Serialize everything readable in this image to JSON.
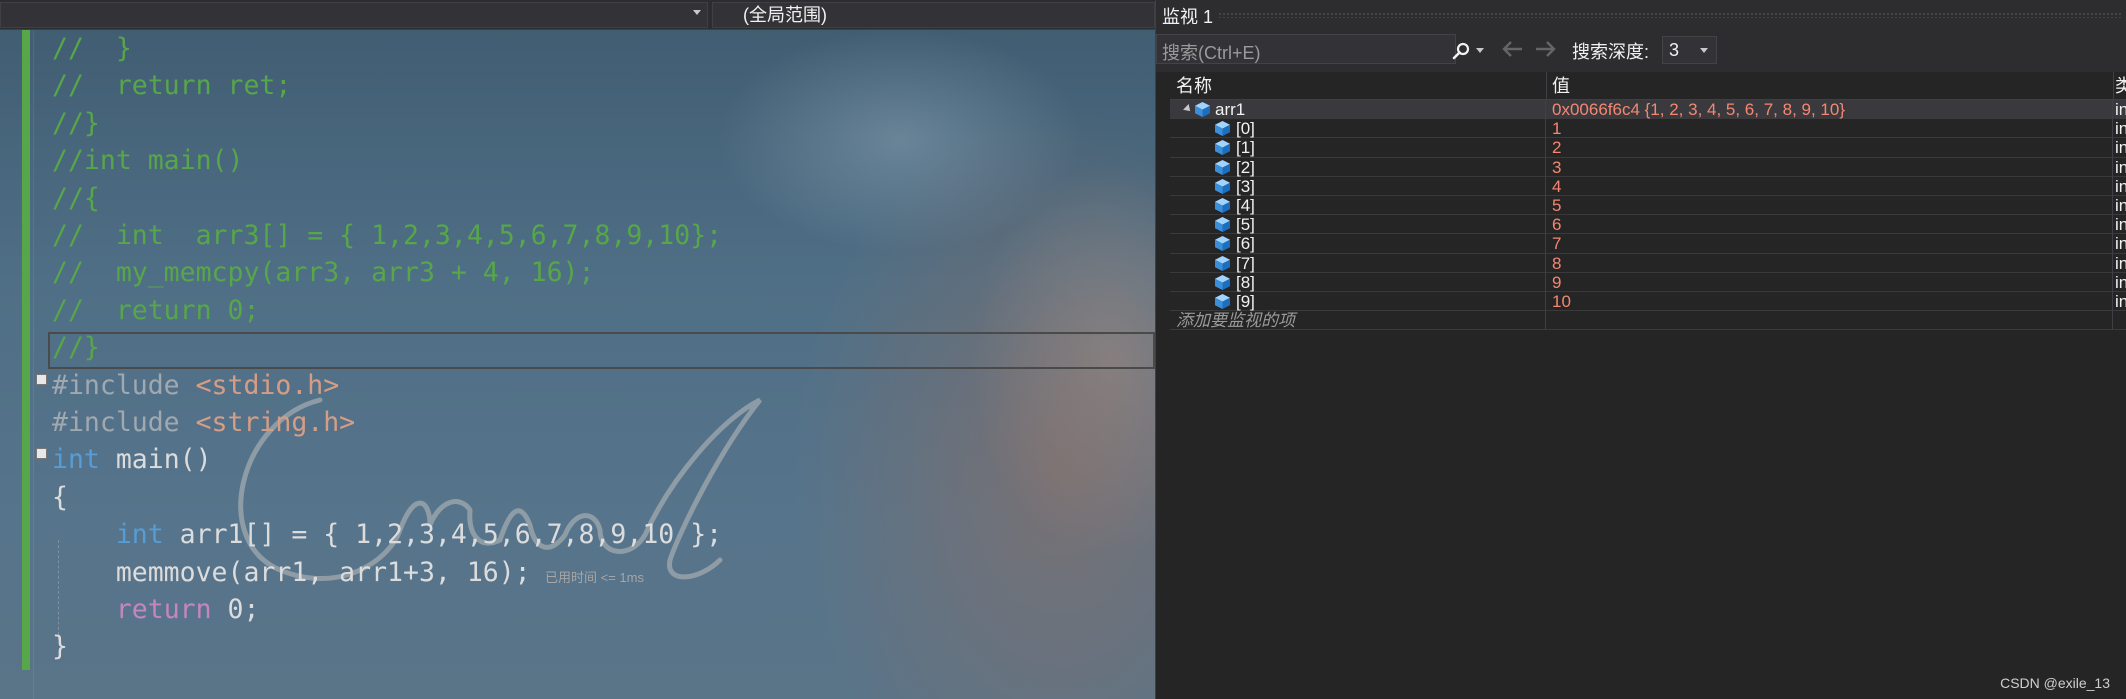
{
  "editor": {
    "scope_label": "(全局范围)",
    "perf_tip": "已用时间 <= 1ms",
    "lines": [
      [
        {
          "t": "//  }",
          "c": "cmt"
        }
      ],
      [
        {
          "t": "//  return ret;",
          "c": "cmt"
        }
      ],
      [
        {
          "t": "//}",
          "c": "cmt"
        }
      ],
      [
        {
          "t": "//int main()",
          "c": "cmt"
        }
      ],
      [
        {
          "t": "//{",
          "c": "cmt"
        }
      ],
      [
        {
          "t": "//  int  arr3[] = { 1,2,3,4,5,6,7,8,9,10};",
          "c": "cmt"
        }
      ],
      [
        {
          "t": "//  my_memcpy(arr3, arr3 + 4, 16);",
          "c": "cmt"
        }
      ],
      [
        {
          "t": "//  return 0;",
          "c": "cmt"
        }
      ],
      [
        {
          "t": "//}",
          "c": "cmt"
        }
      ],
      [
        {
          "t": "#include ",
          "c": "pp"
        },
        {
          "t": "<stdio.h>",
          "c": "str"
        }
      ],
      [
        {
          "t": "#include ",
          "c": "pp"
        },
        {
          "t": "<string.h>",
          "c": "str"
        }
      ],
      [
        {
          "t": "int",
          "c": "kw"
        },
        {
          "t": " main()",
          "c": ""
        }
      ],
      [
        {
          "t": "{",
          "c": ""
        }
      ],
      [
        {
          "t": "    ",
          "c": ""
        },
        {
          "t": "int",
          "c": "kw"
        },
        {
          "t": " arr1[] = { 1,2,3,4,5,6,7,8,9,10 };",
          "c": ""
        }
      ],
      [
        {
          "t": "    memmove(arr1, arr1+3, 16);",
          "c": ""
        }
      ],
      [
        {
          "t": "    ",
          "c": ""
        },
        {
          "t": "return",
          "c": "ret2"
        },
        {
          "t": " 0;",
          "c": ""
        }
      ],
      [
        {
          "t": "}",
          "c": ""
        }
      ]
    ]
  },
  "watch": {
    "title": "监视 1",
    "search_placeholder": "搜索(Ctrl+E)",
    "depth_label": "搜索深度:",
    "depth_value": "3",
    "columns": {
      "name": "名称",
      "value": "值",
      "type": "类"
    },
    "root": {
      "name": "arr1",
      "value": "0x0066f6c4 {1, 2, 3, 4, 5, 6, 7, 8, 9, 10}",
      "type": "in"
    },
    "items": [
      {
        "name": "[0]",
        "value": "1",
        "type": "in"
      },
      {
        "name": "[1]",
        "value": "2",
        "type": "in"
      },
      {
        "name": "[2]",
        "value": "3",
        "type": "in"
      },
      {
        "name": "[3]",
        "value": "4",
        "type": "in"
      },
      {
        "name": "[4]",
        "value": "5",
        "type": "in"
      },
      {
        "name": "[5]",
        "value": "6",
        "type": "in"
      },
      {
        "name": "[6]",
        "value": "7",
        "type": "in"
      },
      {
        "name": "[7]",
        "value": "8",
        "type": "in"
      },
      {
        "name": "[8]",
        "value": "9",
        "type": "in"
      },
      {
        "name": "[9]",
        "value": "10",
        "type": "in"
      }
    ],
    "add_item_text": "添加要监视的项"
  },
  "footer": {
    "credit": "CSDN @exile_13"
  },
  "colors": {
    "comment": "#57a64a",
    "keyword": "#569cd6",
    "string": "#d69d85",
    "watch_value": "#f48771"
  }
}
